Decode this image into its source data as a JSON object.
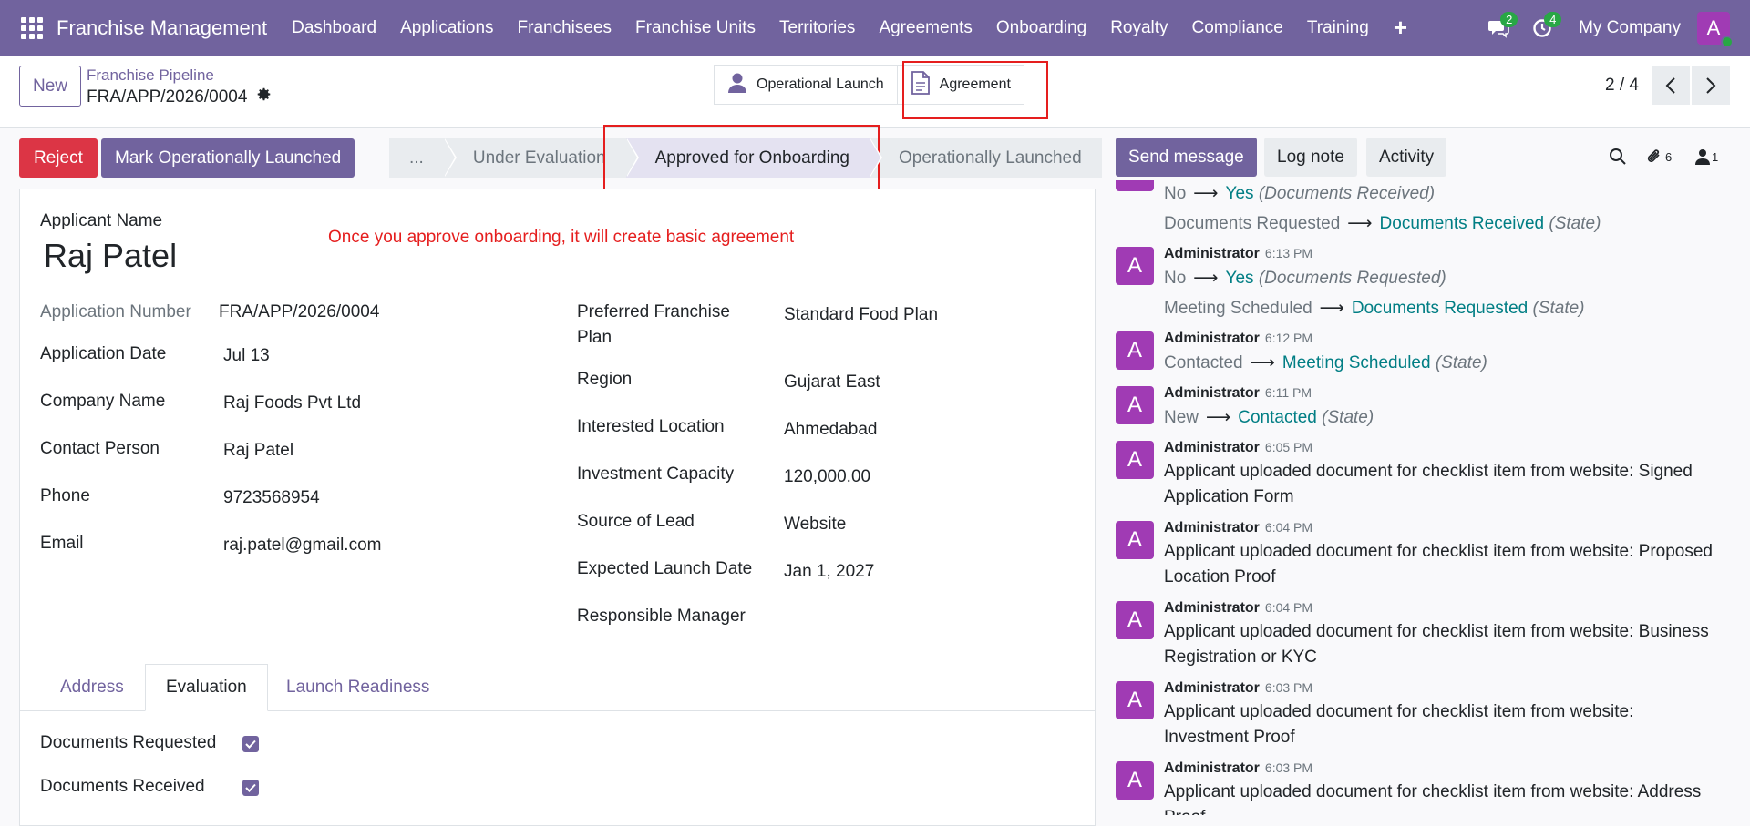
{
  "nav": {
    "brand": "Franchise Management",
    "menu": [
      "Dashboard",
      "Applications",
      "Franchisees",
      "Franchise Units",
      "Territories",
      "Agreements",
      "Onboarding",
      "Royalty",
      "Compliance",
      "Training"
    ],
    "messages_count": "2",
    "activities_count": "4",
    "company": "My Company",
    "avatar_letter": "A"
  },
  "control": {
    "new_label": "New",
    "breadcrumb": "Franchise Pipeline",
    "record_name": "FRA/APP/2026/0004",
    "smart_buttons": [
      "Operational Launch",
      "Agreement"
    ],
    "pager": "2 / 4"
  },
  "actions": {
    "reject": "Reject",
    "mark_launched": "Mark Operationally Launched"
  },
  "statusbar": {
    "stages": [
      "...",
      "Under Evaluation",
      "Approved for Onboarding",
      "Operationally Launched"
    ],
    "active": "Approved for Onboarding"
  },
  "form": {
    "applicant_label": "Applicant Name",
    "applicant_name": "Raj Patel",
    "note": "Once you approve onboarding, it will create basic agreement",
    "left_fields": [
      {
        "label": "Application Number",
        "value": "FRA/APP/2026/0004"
      },
      {
        "label": "Application Date",
        "value": "Jul 13"
      },
      {
        "label": "Company Name",
        "value": "Raj Foods Pvt Ltd"
      },
      {
        "label": "Contact Person",
        "value": "Raj Patel"
      },
      {
        "label": "Phone",
        "value": "9723568954"
      },
      {
        "label": "Email",
        "value": "raj.patel@gmail.com"
      }
    ],
    "right_fields": [
      {
        "label_line1": "Preferred Franchise",
        "label_line2": "Plan",
        "value": "Standard Food Plan"
      },
      {
        "label": "Region",
        "value": "Gujarat East"
      },
      {
        "label": "Interested Location",
        "value": "Ahmedabad"
      },
      {
        "label": "Investment Capacity",
        "value": "120,000.00"
      },
      {
        "label": "Source of Lead",
        "value": "Website"
      },
      {
        "label": "Expected Launch Date",
        "value": "Jan 1, 2027"
      },
      {
        "label": "Responsible Manager",
        "value": ""
      }
    ],
    "tabs": [
      "Address",
      "Evaluation",
      "Launch Readiness"
    ],
    "active_tab": "Evaluation",
    "checkboxes": [
      {
        "label": "Documents Requested",
        "checked": true
      },
      {
        "label": "Documents Received",
        "checked": true
      }
    ]
  },
  "chatter": {
    "send_message": "Send message",
    "log_note": "Log note",
    "activity": "Activity",
    "attachments_count": "6",
    "followers_count": "1",
    "messages": [
      {
        "tracks": [
          {
            "old": "No",
            "new": "Yes",
            "field": "(Documents Received)"
          },
          {
            "old": "Documents Requested",
            "new": "Documents Received",
            "field": "(State)"
          }
        ]
      },
      {
        "author": "Administrator",
        "time": "6:13 PM",
        "tracks": [
          {
            "old": "No",
            "new": "Yes",
            "field": "(Documents Requested)"
          },
          {
            "old": "Meeting Scheduled",
            "new": "Documents Requested",
            "field": "(State)"
          }
        ]
      },
      {
        "author": "Administrator",
        "time": "6:12 PM",
        "tracks": [
          {
            "old": "Contacted",
            "new": "Meeting Scheduled",
            "field": "(State)"
          }
        ]
      },
      {
        "author": "Administrator",
        "time": "6:11 PM",
        "tracks": [
          {
            "old": "New",
            "new": "Contacted",
            "field": "(State)"
          }
        ]
      },
      {
        "author": "Administrator",
        "time": "6:05 PM",
        "body_line1": "Applicant uploaded document for checklist item from website: Signed",
        "body_line2": "Application Form"
      },
      {
        "author": "Administrator",
        "time": "6:04 PM",
        "body_line1": "Applicant uploaded document for checklist item from website: Proposed",
        "body_line2": "Location Proof"
      },
      {
        "author": "Administrator",
        "time": "6:04 PM",
        "body_line1": "Applicant uploaded document for checklist item from website: Business",
        "body_line2": "Registration or KYC"
      },
      {
        "author": "Administrator",
        "time": "6:03 PM",
        "body_line1": "Applicant uploaded document for checklist item from website:",
        "body_line2": "Investment Proof"
      },
      {
        "author": "Administrator",
        "time": "6:03 PM",
        "body_line1": "Applicant uploaded document for checklist item from website: Address",
        "body_line2": "Proof"
      }
    ]
  },
  "colors": {
    "accent": "#71639e",
    "danger": "#dc3545",
    "avatar": "#a03bb4",
    "tracking_new": "#017e84",
    "highlight": "#e51e1e"
  },
  "icons": [
    "apps-grid-icon",
    "plus-icon",
    "chat-icon",
    "clock-icon",
    "gear-icon",
    "user-icon",
    "document-icon",
    "chevron-left-icon",
    "chevron-right-icon",
    "search-icon",
    "paperclip-icon",
    "follower-icon",
    "check-icon"
  ]
}
